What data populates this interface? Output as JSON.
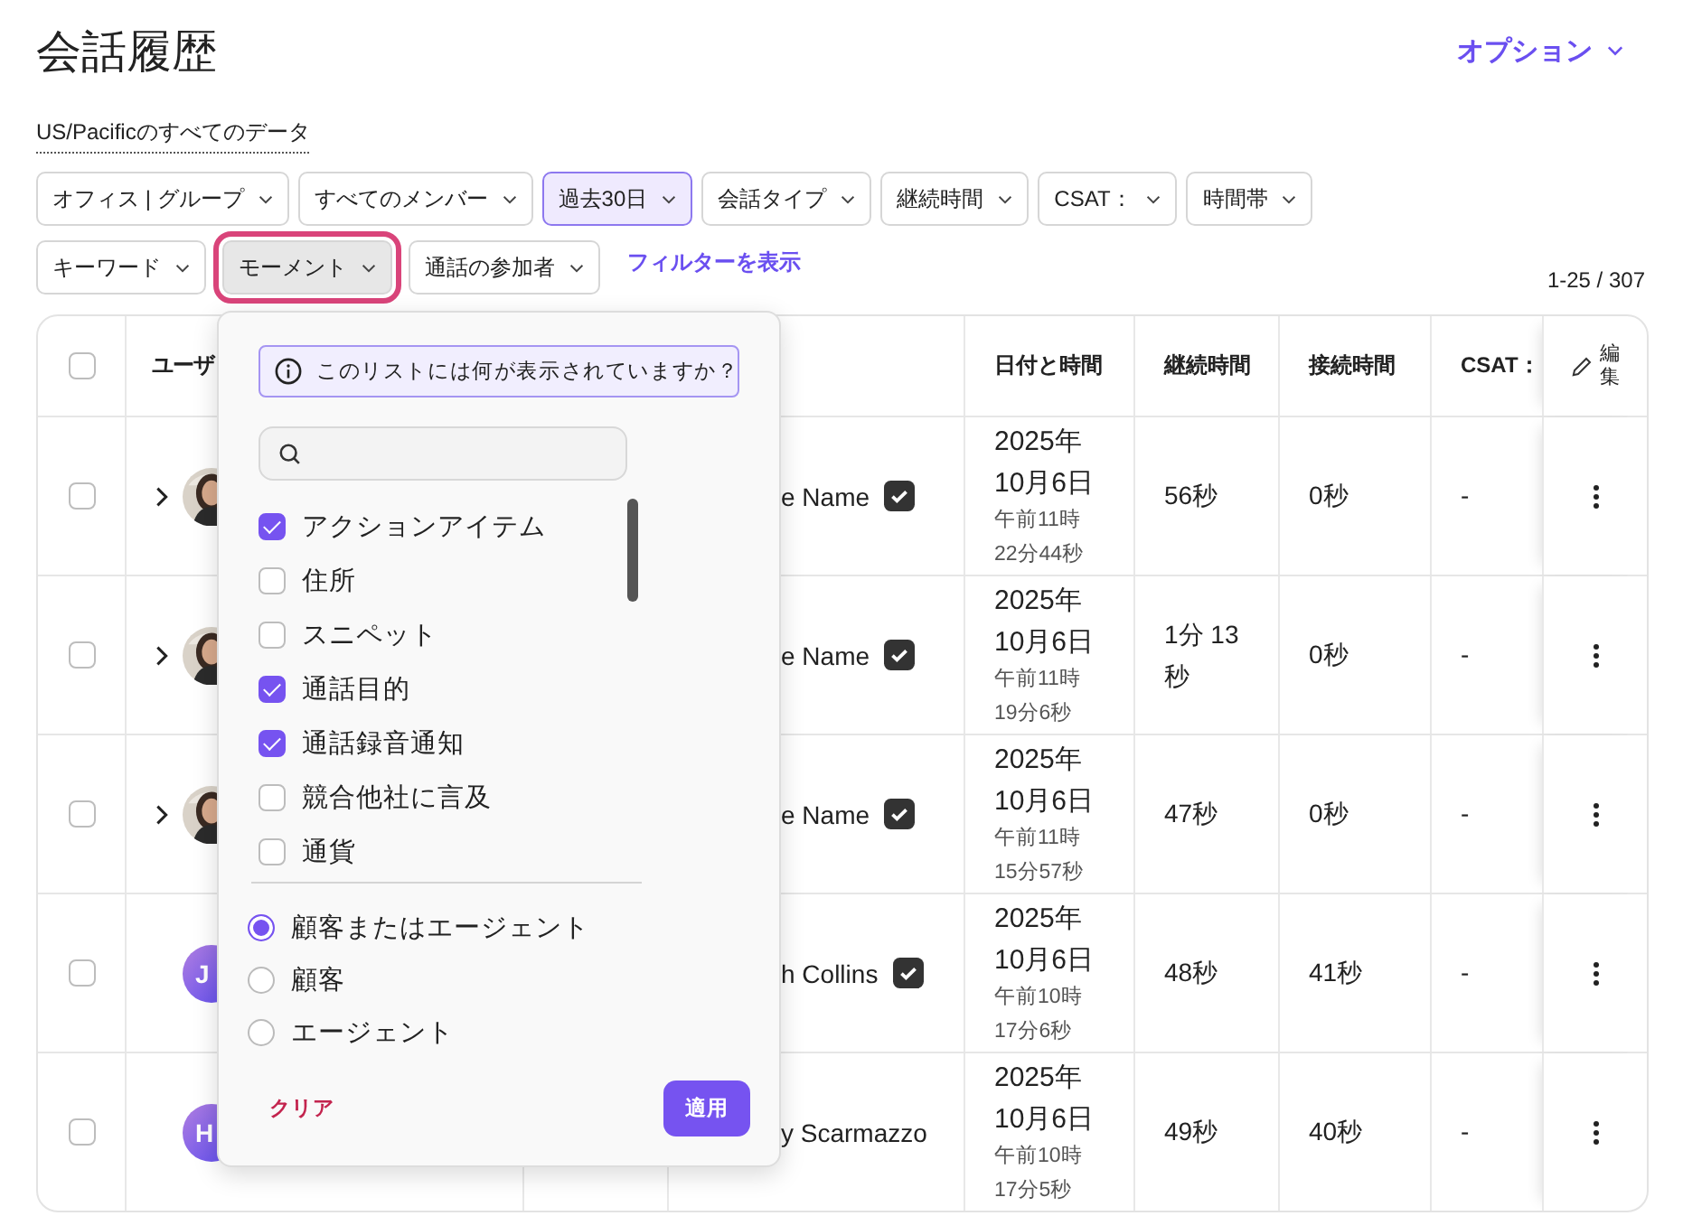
{
  "page": {
    "title": "会話履歴",
    "options": "オプション",
    "timezone_link": "US/Pacificのすべてのデータ"
  },
  "filter_rows": [
    [
      {
        "label": "オフィス | グループ",
        "selected": false,
        "open": false
      },
      {
        "label": "すべてのメンバー",
        "selected": false,
        "open": false
      },
      {
        "label": "過去30日",
        "selected": true,
        "open": false
      },
      {
        "label": "会話タイプ",
        "selected": false,
        "open": false
      },
      {
        "label": "継続時間",
        "selected": false,
        "open": false
      },
      {
        "label": "CSAT：",
        "selected": false,
        "open": false
      },
      {
        "label": "時間帯",
        "selected": false,
        "open": false
      }
    ],
    [
      {
        "label": "キーワード",
        "selected": false,
        "open": false
      },
      {
        "label": "モーメント",
        "selected": false,
        "open": true
      },
      {
        "label": "通話の参加者",
        "selected": false,
        "open": false
      }
    ]
  ],
  "show_filters_link": "フィルターを表示",
  "result_count": "1-25 / 307",
  "table": {
    "select_all_checked": false,
    "header": {
      "user": "ユーザ",
      "date": "日付と時間",
      "duration": "継続時間",
      "connect_time": "接続時間",
      "csat": "CSAT：",
      "edit": "編集"
    },
    "rows": [
      {
        "checked": false,
        "expandable": true,
        "name": "e Name",
        "verified": true,
        "date": "2025年10月6日",
        "time": "午前11時22分44秒",
        "duration": "56秒",
        "connect_time": "0秒",
        "csat": "-"
      },
      {
        "checked": false,
        "expandable": true,
        "name": "e Name",
        "verified": true,
        "date": "2025年10月6日",
        "time": "午前11時19分6秒",
        "duration": "1分 13秒",
        "connect_time": "0秒",
        "csat": "-"
      },
      {
        "checked": false,
        "expandable": true,
        "name": "e Name",
        "verified": true,
        "date": "2025年10月6日",
        "time": "午前11時15分57秒",
        "duration": "47秒",
        "connect_time": "0秒",
        "csat": "-"
      },
      {
        "checked": false,
        "expandable": false,
        "avatar": {
          "kind": "initials",
          "initials": "J"
        },
        "name": "h Collins",
        "verified": true,
        "date": "2025年10月6日",
        "time": "午前10時17分6秒",
        "duration": "48秒",
        "connect_time": "41秒",
        "csat": "-"
      },
      {
        "checked": false,
        "expandable": false,
        "avatar": {
          "kind": "initials",
          "initials": "H"
        },
        "name": "y Scarmazzo",
        "verified": false,
        "date": "2025年10月6日",
        "time": "午前10時17分5秒",
        "duration": "49秒",
        "connect_time": "40秒",
        "csat": "-"
      }
    ]
  },
  "moments_popup": {
    "info": "このリストには何が表示されていますか？",
    "moments": [
      {
        "label": "アクションアイテム",
        "checked": true
      },
      {
        "label": "住所",
        "checked": false
      },
      {
        "label": "スニペット",
        "checked": false
      },
      {
        "label": "通話目的",
        "checked": true
      },
      {
        "label": "通話録音通知",
        "checked": true
      },
      {
        "label": "競合他社に言及",
        "checked": false
      },
      {
        "label": "通貨",
        "checked": false
      }
    ],
    "speakers": [
      {
        "label": "顧客またはエージェント",
        "selected": true
      },
      {
        "label": "顧客",
        "selected": false
      },
      {
        "label": "エージェント",
        "selected": false
      }
    ],
    "clear": "クリア",
    "apply": "適用"
  }
}
